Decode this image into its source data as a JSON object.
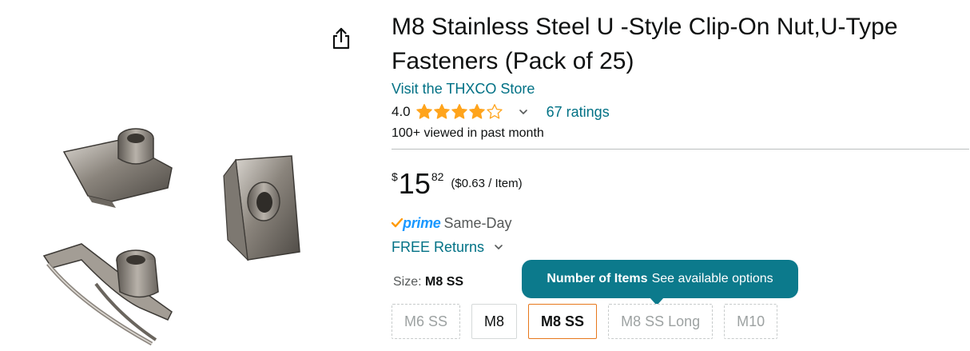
{
  "product": {
    "title": "M8 Stainless Steel U -Style Clip-On Nut,U-Type Fasteners (Pack of 25)",
    "store_link": "Visit the THXCO Store",
    "image_icon": "u-clip-nut-product-image",
    "share_icon": "share-icon"
  },
  "rating": {
    "value": "4.0",
    "stars": 4.0,
    "max_stars": 5,
    "count_label": "67 ratings",
    "star_color": "#ffa41c"
  },
  "social_proof": "100+ viewed in past month",
  "price": {
    "symbol": "$",
    "whole": "15",
    "fraction": "82",
    "per_unit": "($0.63 / Item)"
  },
  "shipping": {
    "prime_label": "prime",
    "speed": "Same-Day",
    "returns": "FREE Returns"
  },
  "size": {
    "label": "Size:",
    "selected": "M8 SS"
  },
  "tooltip": {
    "bold": "Number of Items",
    "text": "See available options",
    "color": "#0c7a8c"
  },
  "size_options": [
    {
      "label": "M6 SS",
      "state": "unavailable"
    },
    {
      "label": "M8",
      "state": "available"
    },
    {
      "label": "M8 SS",
      "state": "selected"
    },
    {
      "label": "M8 SS Long",
      "state": "unavailable"
    },
    {
      "label": "M10",
      "state": "unavailable"
    }
  ],
  "colors": {
    "link": "#007185",
    "selected_border": "#e7781c"
  }
}
